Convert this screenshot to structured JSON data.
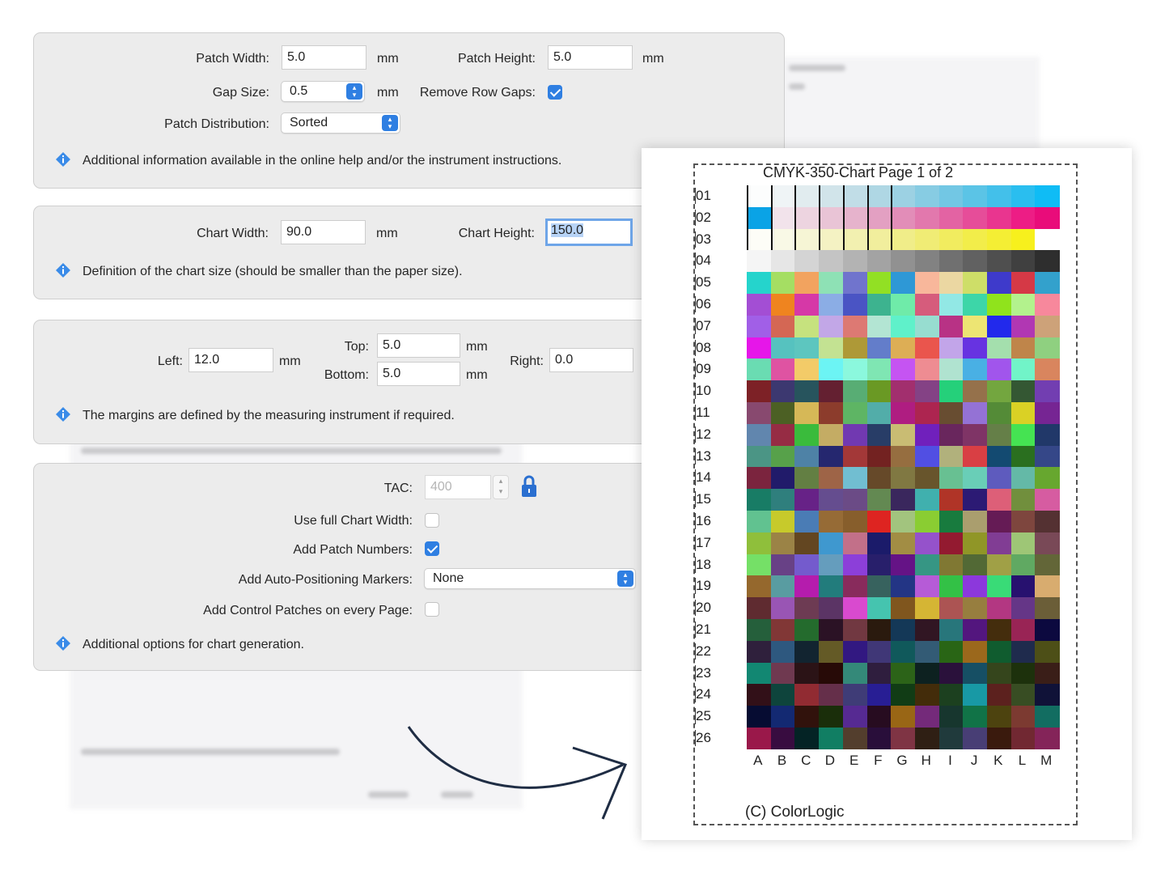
{
  "panel_size": {
    "patch_width_label": "Patch Width:",
    "patch_width": "5.0",
    "patch_width_unit": "mm",
    "patch_height_label": "Patch Height:",
    "patch_height": "5.0",
    "patch_height_unit": "mm",
    "gap_size_label": "Gap Size:",
    "gap_size": "0.5",
    "gap_size_unit": "mm",
    "remove_row_gaps_label": "Remove Row Gaps:",
    "remove_row_gaps": true,
    "patch_distribution_label": "Patch Distribution:",
    "patch_distribution": "Sorted",
    "info": "Additional information available in the online help and/or the instrument instructions."
  },
  "panel_chart": {
    "chart_width_label": "Chart Width:",
    "chart_width": "90.0",
    "chart_width_unit": "mm",
    "chart_height_label": "Chart Height:",
    "chart_height": "150.0",
    "info": "Definition of the chart size (should be smaller than the paper size)."
  },
  "panel_margins": {
    "left_label": "Left:",
    "left": "12.0",
    "left_unit": "mm",
    "top_label": "Top:",
    "top": "5.0",
    "top_unit": "mm",
    "bottom_label": "Bottom:",
    "bottom": "5.0",
    "bottom_unit": "mm",
    "right_label": "Right:",
    "right": "0.0",
    "info": "The margins are defined by the measuring instrument if required."
  },
  "panel_options": {
    "tac_label": "TAC:",
    "tac": "400",
    "full_width_label": "Use full Chart Width:",
    "full_width": false,
    "patch_numbers_label": "Add Patch Numbers:",
    "patch_numbers": true,
    "markers_label": "Add Auto-Positioning Markers:",
    "markers": "None",
    "control_patches_label": "Add Control Patches on every Page:",
    "control_patches": false,
    "info": "Additional options for chart generation."
  },
  "chart": {
    "title": "CMYK-350-Chart Page 1 of 2",
    "rows": [
      "01",
      "02",
      "03",
      "04",
      "05",
      "06",
      "07",
      "08",
      "09",
      "10",
      "11",
      "12",
      "13",
      "14",
      "15",
      "16",
      "17",
      "18",
      "19",
      "20",
      "21",
      "22",
      "23",
      "24",
      "25",
      "26"
    ],
    "columns": [
      "A",
      "B",
      "C",
      "D",
      "E",
      "F",
      "G",
      "H",
      "I",
      "J",
      "K",
      "L",
      "M"
    ],
    "copyright": "(C) ColorLogic"
  },
  "colors": {
    "accent": "#2f7fe2",
    "info_icon": "#3a8be8"
  }
}
